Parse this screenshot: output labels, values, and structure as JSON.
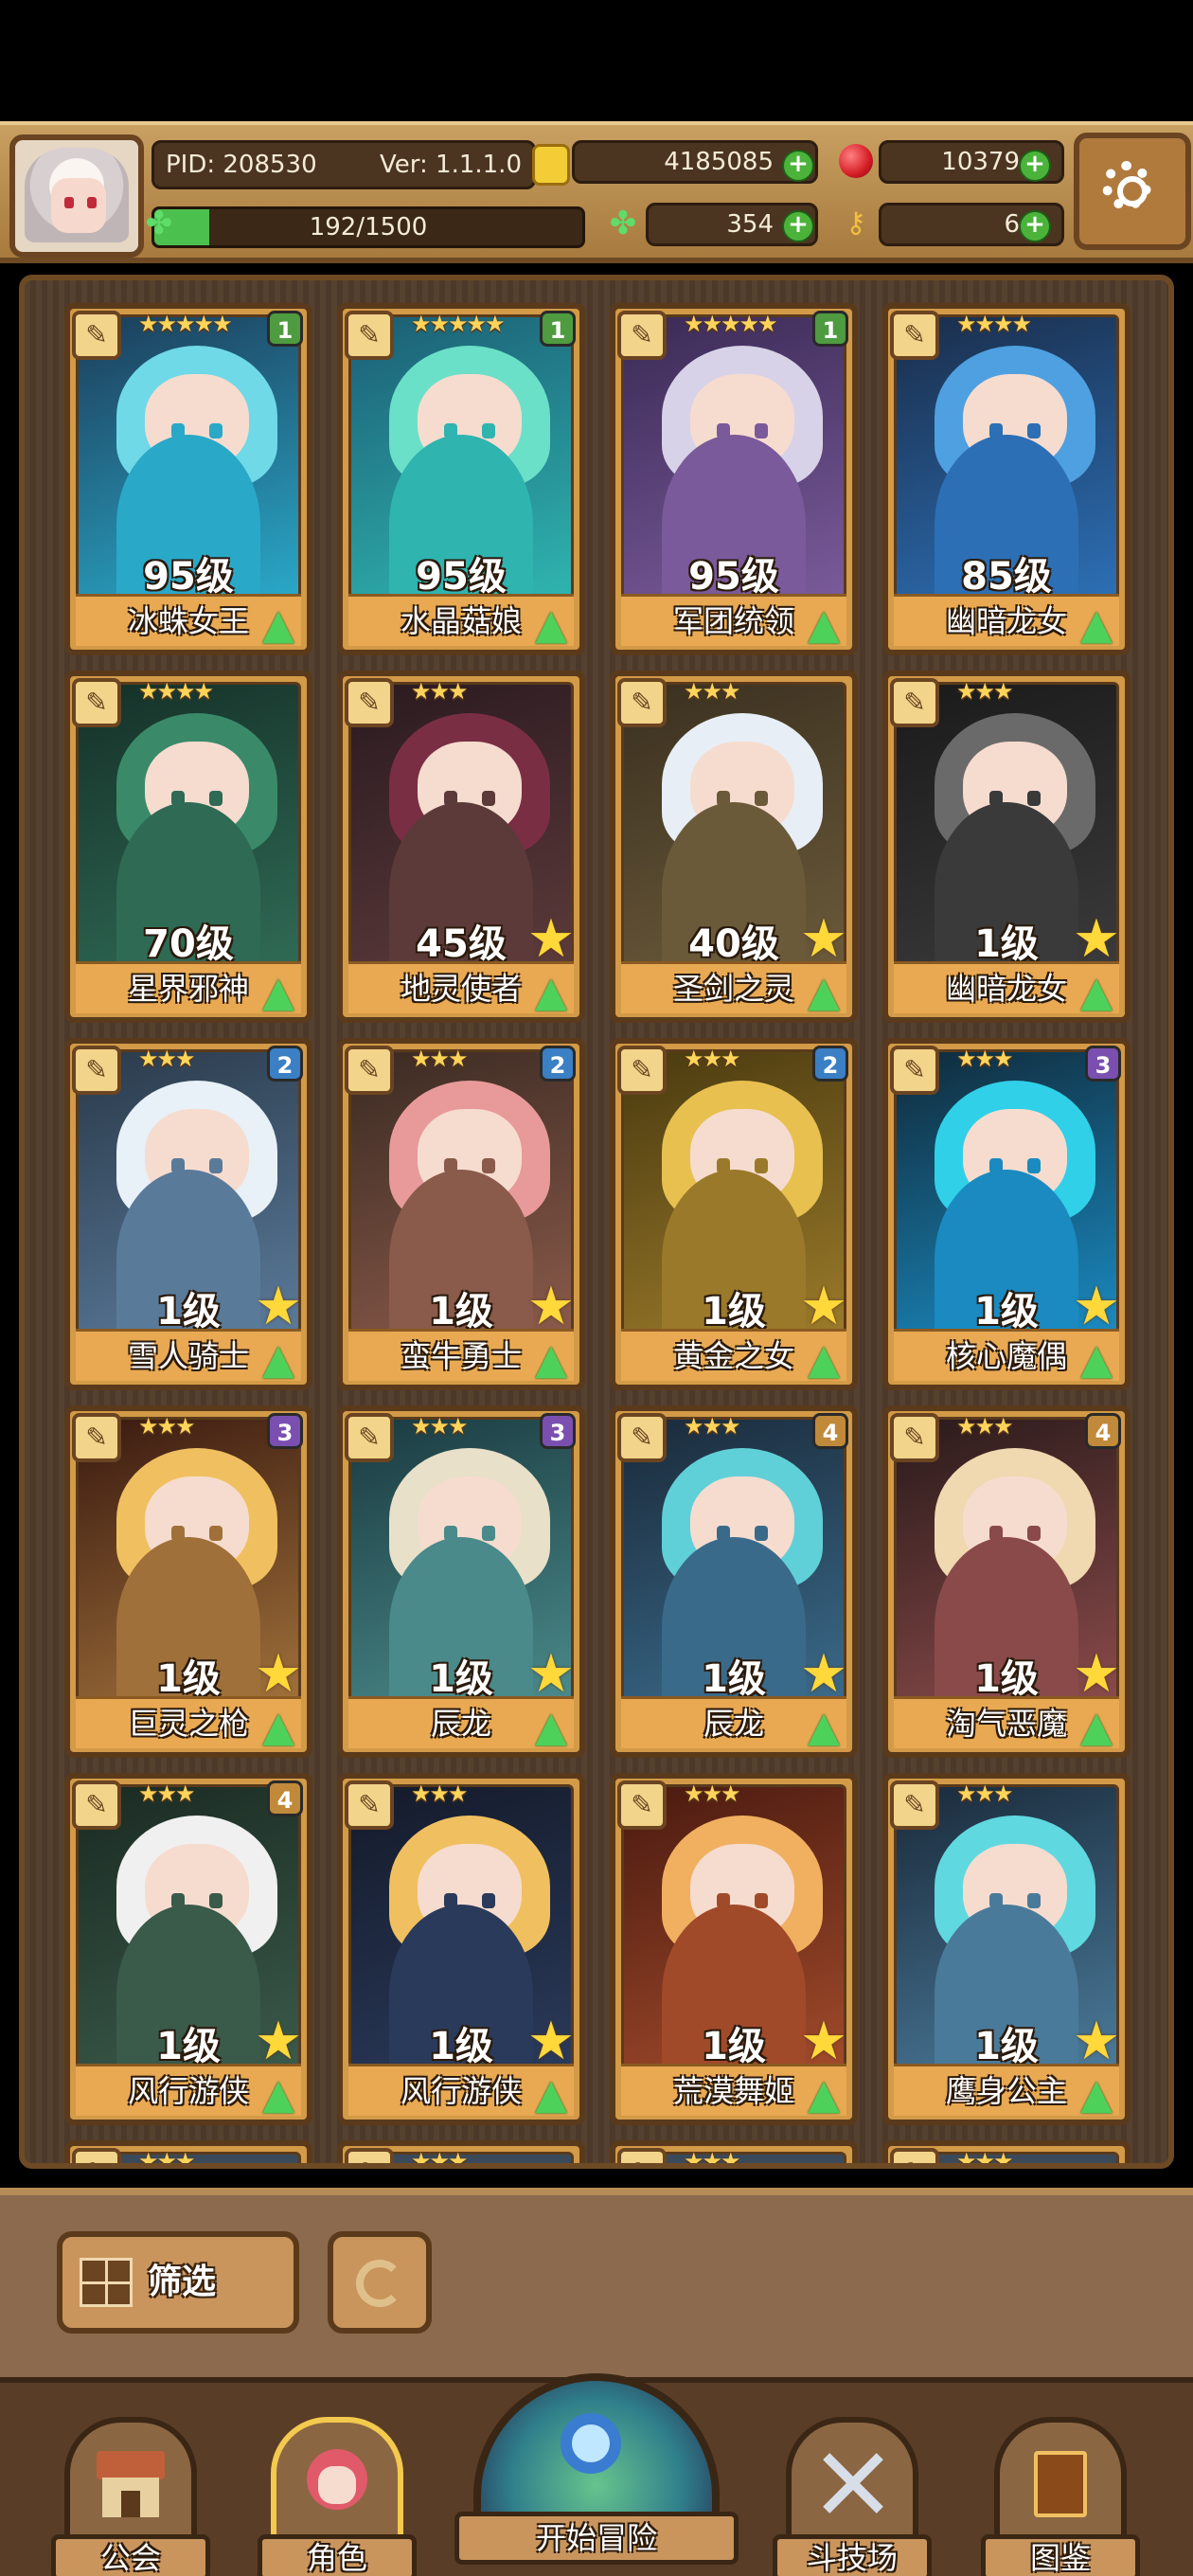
{
  "header": {
    "pid": "PID: 208530",
    "version": "Ver: 1.1.1.0",
    "exp": "192/1500",
    "exp_fraction": 0.128,
    "gold": "4185085",
    "ruby": "10379",
    "clover": "354",
    "keys": "6",
    "colors": {
      "gold": "#f3cd35",
      "ruby": "#d41c24",
      "clover": "#5fdc6a",
      "plus": "#4bb33a"
    }
  },
  "cards": [
    {
      "name": "冰蛛女王",
      "level": "95级",
      "stars": "★★★★★",
      "rank": "1",
      "rank_color": "#4f9b40",
      "palette": [
        "#2aa8c8",
        "#6fd9e8",
        "#1c3d5a"
      ],
      "star_button": false
    },
    {
      "name": "水晶菇娘",
      "level": "95级",
      "stars": "★★★★★",
      "rank": "1",
      "rank_color": "#4f9b40",
      "palette": [
        "#2fb4b0",
        "#6be0c8",
        "#1b5e74"
      ],
      "star_button": false
    },
    {
      "name": "军团统领",
      "level": "95级",
      "stars": "★★★★★",
      "rank": "1",
      "rank_color": "#4f9b40",
      "palette": [
        "#7a5a9a",
        "#d7d2e8",
        "#3a2a55"
      ],
      "star_button": false
    },
    {
      "name": "幽暗龙女",
      "level": "85级",
      "stars": "★★★★",
      "rank": "",
      "rank_color": "",
      "palette": [
        "#2c6fb5",
        "#4ea0e0",
        "#1a2d4a"
      ],
      "star_button": false
    },
    {
      "name": "星界邪神",
      "level": "70级",
      "stars": "★★★★",
      "rank": "",
      "rank_color": "#5a2a8a",
      "palette": [
        "#2f6a55",
        "#3a8a6a",
        "#153028"
      ],
      "star_button": false
    },
    {
      "name": "地灵使者",
      "level": "45级",
      "stars": "★★★",
      "rank": "",
      "rank_color": "",
      "palette": [
        "#5c3a3a",
        "#7a2e44",
        "#2a1a20"
      ],
      "star_button": true
    },
    {
      "name": "圣剑之灵",
      "level": "40级",
      "stars": "★★★",
      "rank": "",
      "rank_color": "",
      "palette": [
        "#6b5a3a",
        "#e8eef5",
        "#3a3020"
      ],
      "star_button": true
    },
    {
      "name": "幽暗龙女",
      "level": "1级",
      "stars": "★★★",
      "rank": "",
      "rank_color": "",
      "palette": [
        "#3a3a3a",
        "#6a6a6a",
        "#1a1a1a"
      ],
      "star_button": true
    },
    {
      "name": "雪人骑士",
      "level": "1级",
      "stars": "★★★",
      "rank": "2",
      "rank_color": "#3b7fc4",
      "palette": [
        "#5a7a9a",
        "#e8f0f8",
        "#2a3a4a"
      ],
      "star_button": true
    },
    {
      "name": "蛮牛勇士",
      "level": "1级",
      "stars": "★★★",
      "rank": "2",
      "rank_color": "#3b7fc4",
      "palette": [
        "#8a5a4a",
        "#e89a9a",
        "#3a2a22"
      ],
      "star_button": true
    },
    {
      "name": "黄金之女",
      "level": "1级",
      "stars": "★★★",
      "rank": "2",
      "rank_color": "#3b7fc4",
      "palette": [
        "#9a7a2a",
        "#e8c050",
        "#4a3a10"
      ],
      "star_button": true
    },
    {
      "name": "核心魔偶",
      "level": "1级",
      "stars": "★★★",
      "rank": "3",
      "rank_color": "#7a4fb0",
      "palette": [
        "#1a8ac0",
        "#30d0e8",
        "#102a3a"
      ],
      "star_button": true
    },
    {
      "name": "巨灵之枪",
      "level": "1级",
      "stars": "★★★",
      "rank": "3",
      "rank_color": "#7a4fb0",
      "palette": [
        "#a0703a",
        "#f0c060",
        "#3a1a10"
      ],
      "star_button": true
    },
    {
      "name": "辰龙",
      "level": "1级",
      "stars": "★★★",
      "rank": "3",
      "rank_color": "#7a4fb0",
      "palette": [
        "#4a8a8a",
        "#e8e0c8",
        "#1a3a40"
      ],
      "star_button": true
    },
    {
      "name": "辰龙",
      "level": "1级",
      "stars": "★★★",
      "rank": "4",
      "rank_color": "#c08a3a",
      "palette": [
        "#3a6a8a",
        "#60d0d8",
        "#1a2a3a"
      ],
      "star_button": true
    },
    {
      "name": "淘气恶魔",
      "level": "1级",
      "stars": "★★★",
      "rank": "4",
      "rank_color": "#c08a3a",
      "palette": [
        "#8a4a4a",
        "#f0d8b0",
        "#2a1a1a"
      ],
      "star_button": true
    },
    {
      "name": "风行游侠",
      "level": "1级",
      "stars": "★★★",
      "rank": "4",
      "rank_color": "#c08a3a",
      "palette": [
        "#3a5a4a",
        "#f0f0f0",
        "#1a2a22"
      ],
      "star_button": true
    },
    {
      "name": "风行游侠",
      "level": "1级",
      "stars": "★★★",
      "rank": "",
      "rank_color": "",
      "palette": [
        "#2a3a5a",
        "#f0c060",
        "#141a2a"
      ],
      "star_button": true
    },
    {
      "name": "荒漠舞姬",
      "level": "1级",
      "stars": "★★★",
      "rank": "",
      "rank_color": "",
      "palette": [
        "#a04a2a",
        "#f0b060",
        "#4a1a10"
      ],
      "star_button": true
    },
    {
      "name": "鹰身公主",
      "level": "1级",
      "stars": "★★★",
      "rank": "",
      "rank_color": "",
      "palette": [
        "#4a7a9a",
        "#60d8e0",
        "#1a2a3a"
      ],
      "star_button": true
    }
  ],
  "toolbar": {
    "filter_label": "筛选"
  },
  "nav": {
    "guild": "公会",
    "characters": "角色",
    "start": "开始冒险",
    "arena": "斗技场",
    "codex": "图鉴"
  }
}
